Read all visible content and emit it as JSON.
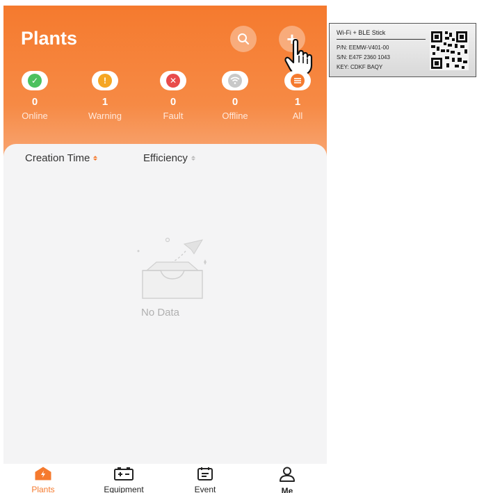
{
  "header": {
    "title": "Plants"
  },
  "stats": [
    {
      "label": "Online",
      "count": "0",
      "color": "#4cc15f",
      "glyph": "✓",
      "icon": "check-icon"
    },
    {
      "label": "Warning",
      "count": "1",
      "color": "#f5a623",
      "glyph": "!",
      "icon": "warning-icon"
    },
    {
      "label": "Fault",
      "count": "0",
      "color": "#e84b4b",
      "glyph": "✕",
      "icon": "fault-icon"
    },
    {
      "label": "Offline",
      "count": "0",
      "color": "#c8c8c8",
      "glyph": "",
      "icon": "wifi-icon"
    },
    {
      "label": "All",
      "count": "1",
      "color": "#f57a2e",
      "glyph": "",
      "icon": "list-icon"
    }
  ],
  "sort": {
    "creation_time": "Creation Time",
    "efficiency": "Efficiency"
  },
  "empty_state": {
    "text": "No Data"
  },
  "tabbar": {
    "items": [
      {
        "label": "Plants",
        "icon": "plants-icon",
        "active": true
      },
      {
        "label": "Equipment",
        "icon": "equipment-icon",
        "active": false
      },
      {
        "label": "Event",
        "icon": "event-icon",
        "active": false
      },
      {
        "label": "Me",
        "icon": "me-icon",
        "active": false
      }
    ]
  },
  "sticker": {
    "title": "Wi-Fi + BLE Stick",
    "pn": "P/N:  EEMW-V401-00",
    "sn": "S/N:  E47F 2360 1043",
    "key": "KEY:  CDKF BAQY"
  },
  "colors": {
    "accent": "#f57a2e"
  }
}
